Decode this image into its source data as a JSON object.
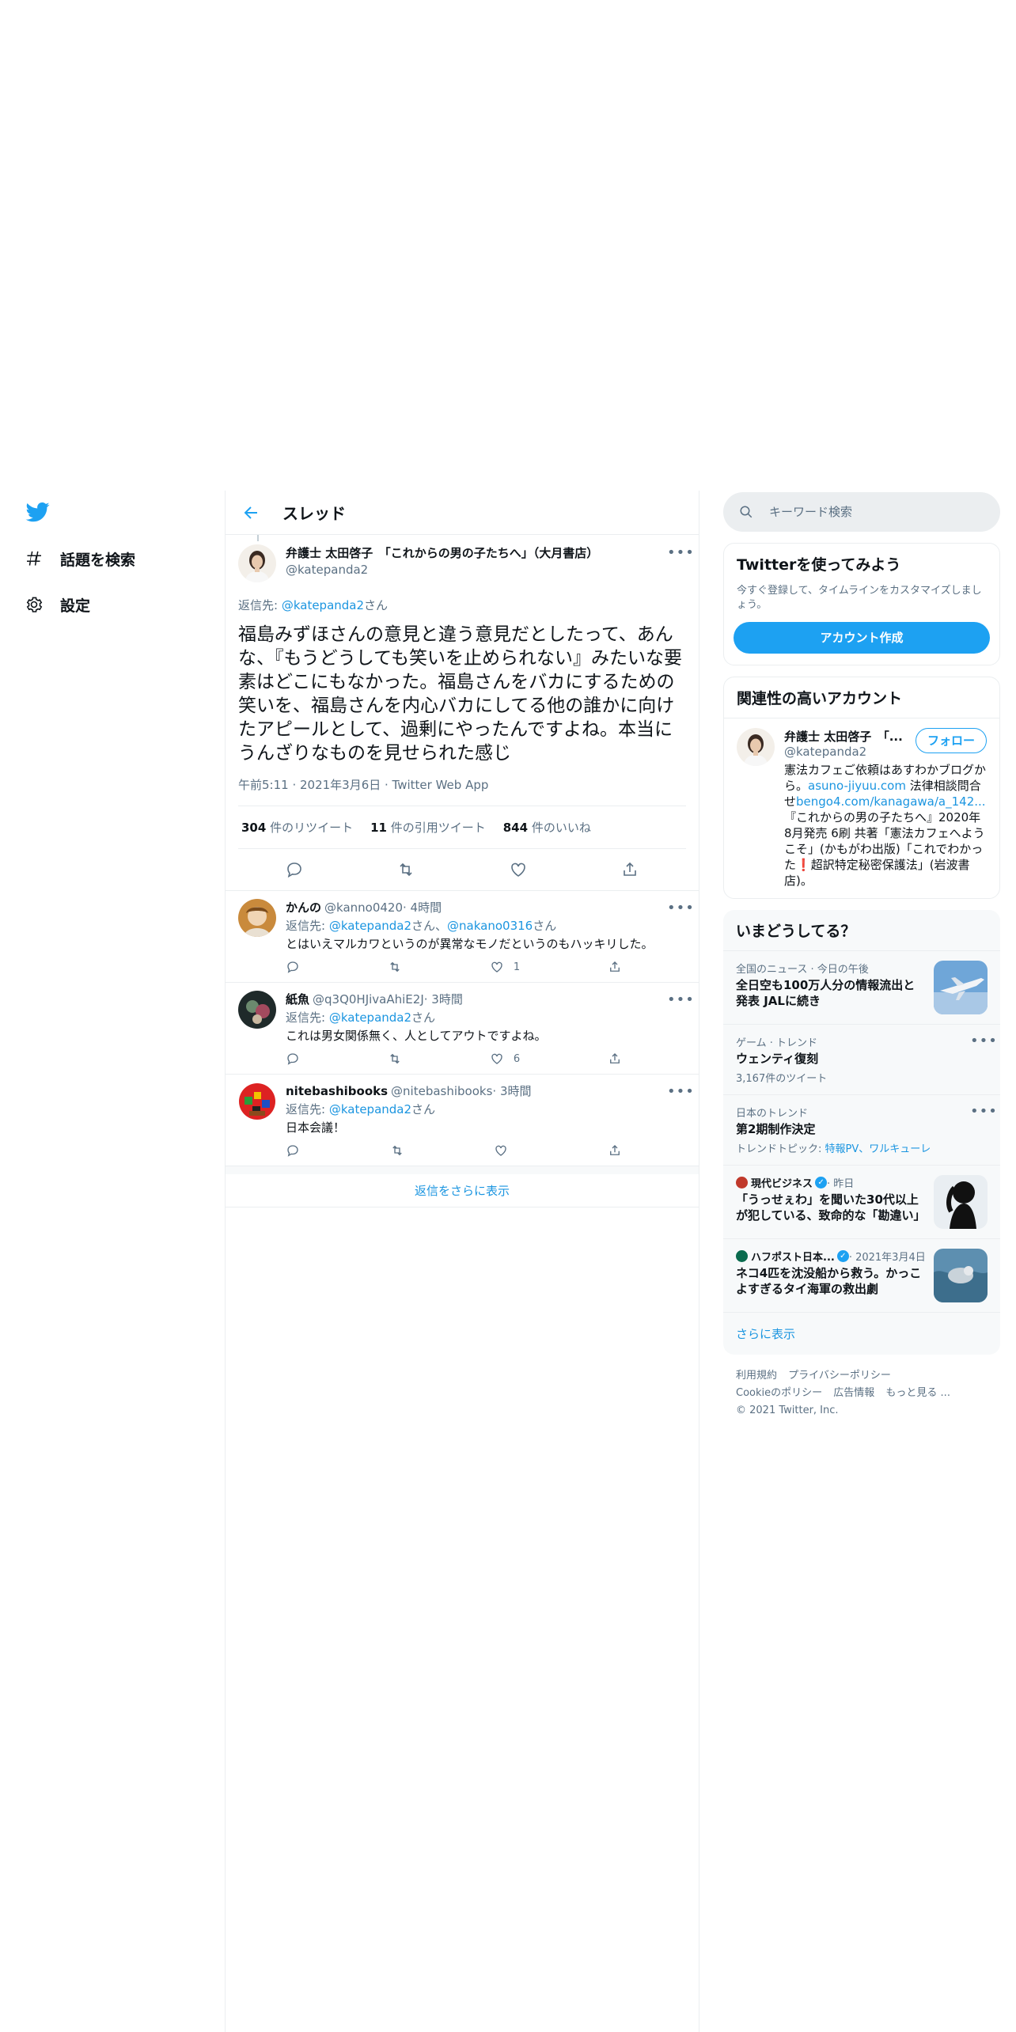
{
  "leftnav": {
    "items": [
      {
        "icon": "hashtag-icon",
        "label": "話題を検索"
      },
      {
        "icon": "gear-icon",
        "label": "設定"
      }
    ]
  },
  "main": {
    "header_title": "スレッド",
    "tweet": {
      "name": "弁護士 太田啓子　「これからの男の子たちへ」（大月書店）",
      "handle": "@katepanda2",
      "reply_prefix": "返信先: ",
      "reply_to": "@katepanda2",
      "reply_suffix": "さん",
      "text": "福島みずほさんの意見と違う意見だとしたって、あんな、『もうどうしても笑いを止められない』みたいな要素はどこにもなかった。福島さんをバカにするための笑いを、福島さんを内心バカにしてる他の誰かに向けたアピールとして、過剰にやったんですよね。本当にうんざりなものを見せられた感じ",
      "timestamp": "午前5:11 · 2021年3月6日 · Twitter Web App",
      "stats": {
        "retweets": "304",
        "retweets_label": " 件のリツイート",
        "quotes": "11",
        "quotes_label": " 件の引用ツイート",
        "likes": "844",
        "likes_label": " 件のいいね"
      }
    },
    "replies": [
      {
        "name": "かんの",
        "handle": "@kanno0420",
        "time": " · 4時間",
        "reply_prefix": "返信先: ",
        "reply_to_1": "@katepanda2",
        "reply_mid": "さん、",
        "reply_to_2": "@nakano0316",
        "reply_suffix": "さん",
        "text": "とはいえマルカワというのが異常なモノだというのもハッキリした。",
        "likes": "1"
      },
      {
        "name": "紙魚",
        "handle": "@q3Q0HJivaAhiE2J",
        "time": " · 3時間",
        "reply_prefix": "返信先: ",
        "reply_to_1": "@katepanda2",
        "reply_suffix": "さん",
        "text": "これは男女関係無く、人としてアウトですよね。",
        "likes": "6"
      },
      {
        "name": "nitebashibooks",
        "handle": "@nitebashibooks",
        "time": " · 3時間",
        "reply_prefix": "返信先: ",
        "reply_to_1": "@katepanda2",
        "reply_suffix": "さん",
        "text": "日本会議！",
        "likes": ""
      }
    ],
    "show_more": "返信をさらに表示"
  },
  "right": {
    "search_placeholder": "キーワード検索",
    "signup": {
      "title": "Twitterを使ってみよう",
      "desc": "今すぐ登録して、タイムラインをカスタマイズしましょう。",
      "button": "アカウント作成"
    },
    "related": {
      "title": "関連性の高いアカウント",
      "name": "弁護士 太田啓子　「...",
      "handle": "@katepanda2",
      "follow": "フォロー",
      "bio_1": "憲法カフェご依頼はあすわかブログから。",
      "bio_link_1": "asuno-jiyuu.com",
      "bio_2": " 法律相談問合せ",
      "bio_link_2": "bengo4.com/kanagawa/a_142...",
      "bio_3": "『これからの男の子たちへ』2020年8月発売 6刷 共著「憲法カフェへようこそ」(かもがわ出版)「これでわかった",
      "bio_emoji": "❗",
      "bio_4": "超訳特定秘密保護法」(岩波書店)。"
    },
    "trends": {
      "title": "いまどうしてる？",
      "items": [
        {
          "meta": "全国のニュース · 今日の午後",
          "title": "全日空も100万人分の情報流出と発表 JALに続き",
          "sub": "",
          "thumb": "airplane"
        },
        {
          "meta": "ゲーム · トレンド",
          "title": "ウェンティ復刻",
          "sub": "3,167件のツイート",
          "thumb": ""
        },
        {
          "meta": "日本のトレンド",
          "title": "第2期制作決定",
          "sub_prefix": "トレンドトピック: ",
          "sub_link": "特報PV、ワルキューレ",
          "thumb": ""
        },
        {
          "source": "現代ビジネス",
          "meta": " · 昨日",
          "title": "「うっせぇわ」を聞いた30代以上が犯している、致命的な「勘違い」",
          "thumb": "silhouette"
        },
        {
          "source": "ハフポスト日本...",
          "meta": " · 2021年3月4日",
          "title": "ネコ4匹を沈没船から救う。かっこよすぎるタイ海軍の救出劇",
          "thumb": "sea"
        }
      ],
      "more": "さらに表示"
    },
    "footer": {
      "links": [
        "利用規約",
        "プライバシーポリシー",
        "Cookieのポリシー",
        "広告情報",
        "もっと見る ..."
      ],
      "copyright": "© 2021 Twitter, Inc."
    }
  },
  "colors": {
    "accent": "#1da1f2",
    "link": "#1b95e0",
    "secondary_text": "#5b7083",
    "border": "#ebeef0"
  }
}
